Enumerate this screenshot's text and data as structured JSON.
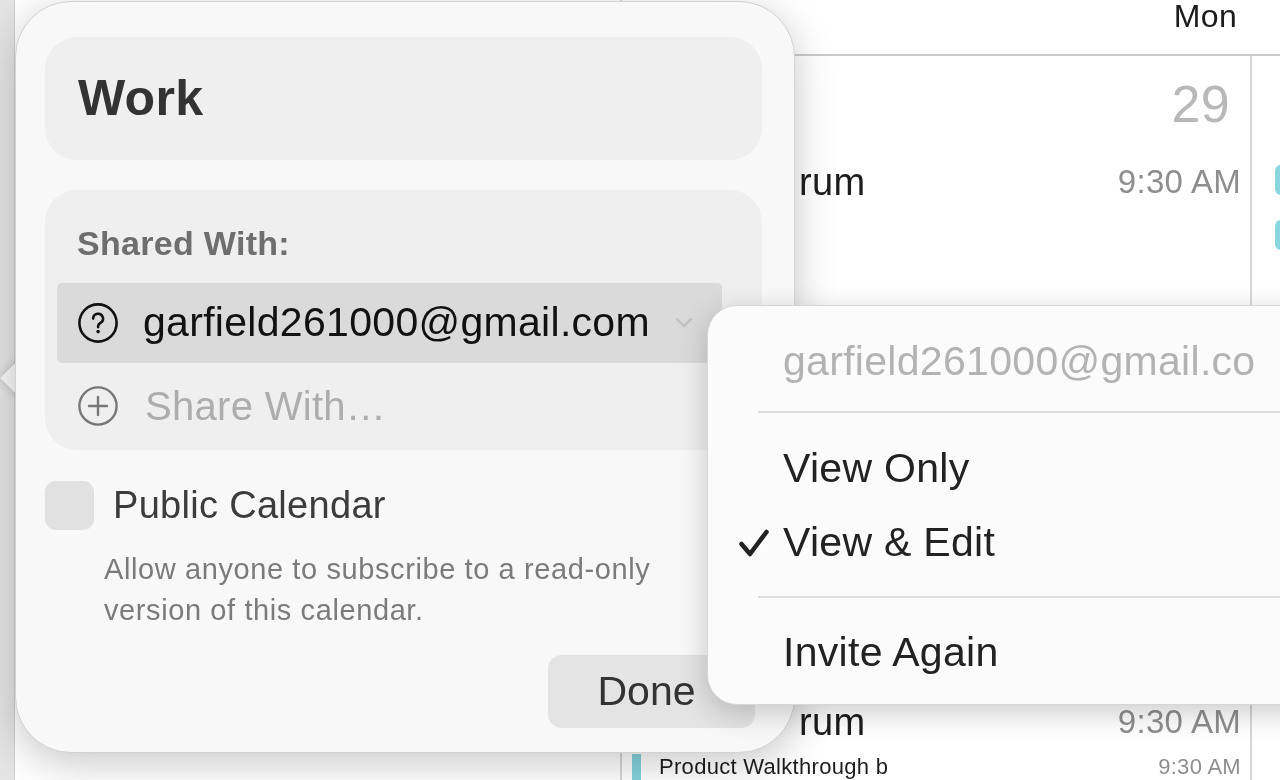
{
  "calendar": {
    "day_label": "Mon",
    "date": "29",
    "events": [
      {
        "kind": "clipped",
        "title": "rum",
        "time": "9:30 AM"
      },
      {
        "kind": "clipped",
        "title": "rum",
        "time": "9:30 AM"
      },
      {
        "kind": "event",
        "title": "Product Walkthrough b",
        "time": "9:30 AM"
      }
    ]
  },
  "popover": {
    "calendar_name": "Work",
    "shared_with_label": "Shared With:",
    "invitees": [
      {
        "kind": "pending",
        "email": "garfield261000@gmail.com",
        "selected": true
      }
    ],
    "share_field": {
      "placeholder": "Share With…"
    },
    "public_calendar": {
      "label": "Public Calendar",
      "checked": false,
      "description": "Allow anyone to subscribe to a read-only version of this calendar."
    },
    "done_button": "Done"
  },
  "context_menu": {
    "header": "garfield261000@gmail.co",
    "items": [
      {
        "kind": "option",
        "label": "View Only",
        "checked": false
      },
      {
        "kind": "option",
        "label": "View & Edit",
        "checked": true
      },
      {
        "kind": "separator"
      },
      {
        "kind": "action",
        "label": "Invite Again"
      }
    ]
  }
}
